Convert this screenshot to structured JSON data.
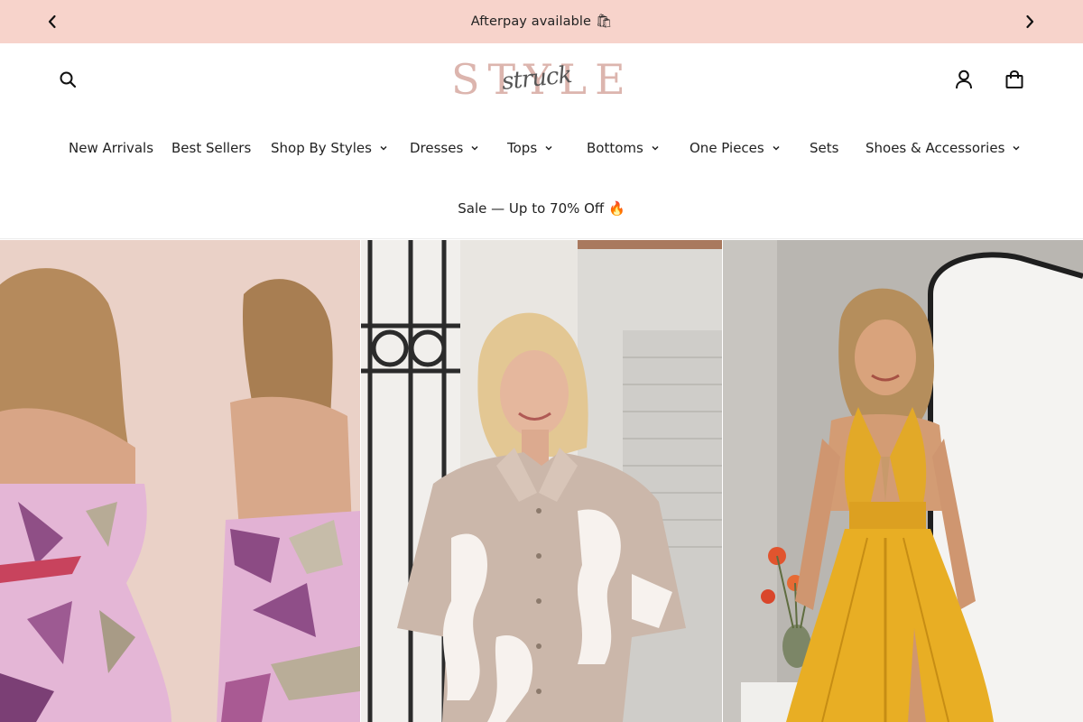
{
  "announcement": {
    "text": "Afterpay available 🛍",
    "prev_icon": "chevron-left-icon",
    "next_icon": "chevron-right-icon",
    "background": "#f7d3cb"
  },
  "header": {
    "logo": {
      "word": "STYLE",
      "script": "struck"
    },
    "icons": {
      "search": "search-icon",
      "account": "user-icon",
      "cart": "shopping-bag-icon"
    }
  },
  "nav": {
    "items": [
      {
        "label": "New Arrivals",
        "has_dropdown": false
      },
      {
        "label": "Best Sellers",
        "has_dropdown": false
      },
      {
        "label": "Shop By Styles",
        "has_dropdown": true
      },
      {
        "label": "Dresses",
        "has_dropdown": true
      },
      {
        "label": "Tops",
        "has_dropdown": true
      },
      {
        "label": "Bottoms",
        "has_dropdown": true
      },
      {
        "label": "One Pieces",
        "has_dropdown": true
      },
      {
        "label": "Sets",
        "has_dropdown": false
      },
      {
        "label": "Shoes & Accessories",
        "has_dropdown": true
      }
    ],
    "sale": "Sale — Up to 70% Off 🔥"
  },
  "hero": {
    "panels": [
      {
        "subject": "pink abstract print strapless maxi dress",
        "accent": "#e6b5d6"
      },
      {
        "subject": "taupe and white abstract knit button shirt",
        "accent": "#c9b3a6"
      },
      {
        "subject": "mustard yellow halter maxi dress",
        "accent": "#e5ad22"
      }
    ]
  }
}
